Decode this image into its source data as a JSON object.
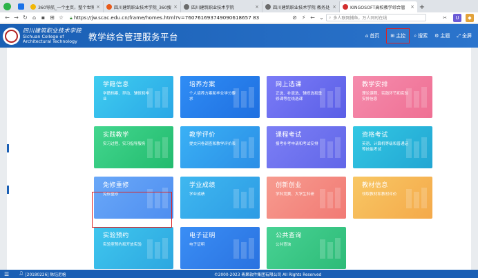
{
  "browser": {
    "tabs": [
      {
        "title": "360导航_一个主页，整个世界",
        "color": "#f2b705"
      },
      {
        "title": "四川建筑职业技术学院_360搜",
        "color": "#e85a1a"
      },
      {
        "title": "四川建筑职业技术学院",
        "color": "#6b6b6b"
      },
      {
        "title": "四川建筑职业技术学院 教务处",
        "color": "#6b6b6b"
      },
      {
        "title": "KINGOSOFT高校教学综合管",
        "color": "#d32f2f"
      }
    ],
    "url": "https://jw.scac.edu.cn/frame/homes.html?v=760761693749090618657 83",
    "search_placeholder": "多人联网捕鱼，万人同时在线"
  },
  "header": {
    "school_cn": "四川建筑职业技术学院",
    "school_en_1": "Sichuan College of",
    "school_en_2": "Architectural Technology",
    "app_title": "教学综合管理服务平台",
    "nav": [
      {
        "label": "首页",
        "icon": "home-icon"
      },
      {
        "label": "主控",
        "icon": "windows-icon"
      },
      {
        "label": "搜索",
        "icon": "search-icon"
      },
      {
        "label": "主题",
        "icon": "theme-icon"
      },
      {
        "label": "全屏",
        "icon": "fullscreen-icon"
      }
    ]
  },
  "tiles": [
    {
      "title": "学籍信息",
      "desc": "学籍档案、异动、辅修和毕业",
      "from": "#3fcdf0",
      "to": "#2aa7e6"
    },
    {
      "title": "培养方案",
      "desc": "个人培养方案和毕业学分要求",
      "from": "#2f8df5",
      "to": "#1f6fe0"
    },
    {
      "title": "网上选课",
      "desc": "正选、补退选、辅修选和重修课等在线选课",
      "from": "#7b7cf7",
      "to": "#5a5ee6"
    },
    {
      "title": "教学安排",
      "desc": "理论课程、实践环节和实验安排信息",
      "from": "#f58cad",
      "to": "#ef6f93"
    },
    {
      "title": "实践教学",
      "desc": "实习过程、实习指导服务",
      "from": "#43d68e",
      "to": "#22bb6e"
    },
    {
      "title": "教学评价",
      "desc": "提交问卷调查和教学评价表",
      "from": "#3ab1f5",
      "to": "#2b8ee6"
    },
    {
      "title": "课程考试",
      "desc": "报考补考申请和考试安排",
      "from": "#7c7ff5",
      "to": "#6166e8"
    },
    {
      "title": "资格考试",
      "desc": "英语、计算机等级和普通话等技能考试",
      "from": "#32c7e3",
      "to": "#22a6d3"
    },
    {
      "title": "免修重修",
      "desc": "免修重修",
      "from": "#6aa8f8",
      "to": "#4e8ef0"
    },
    {
      "title": "学业成绩",
      "desc": "学业成绩",
      "from": "#3fb8f0",
      "to": "#2d9be4"
    },
    {
      "title": "创新创业",
      "desc": "学科竞赛、大学生科研",
      "from": "#f79b8f",
      "to": "#f17a74"
    },
    {
      "title": "教材信息",
      "desc": "领取教材和教材评价",
      "from": "#f8c764",
      "to": "#f4a94a"
    },
    {
      "title": "实验预约",
      "desc": "实验室预约和开放实验",
      "from": "#3fc6ee",
      "to": "#2da7e0"
    },
    {
      "title": "电子证明",
      "desc": "电子证明",
      "from": "#3a8ef5",
      "to": "#2a72e0"
    },
    {
      "title": "公共查询",
      "desc": "公共查询",
      "from": "#48d294",
      "to": "#2dbb77"
    }
  ],
  "footer": {
    "user": "[20180226] 陈钰尼格",
    "copyright": "©2000-2023 青果软件集团有限公司 All Rights Reserved"
  }
}
